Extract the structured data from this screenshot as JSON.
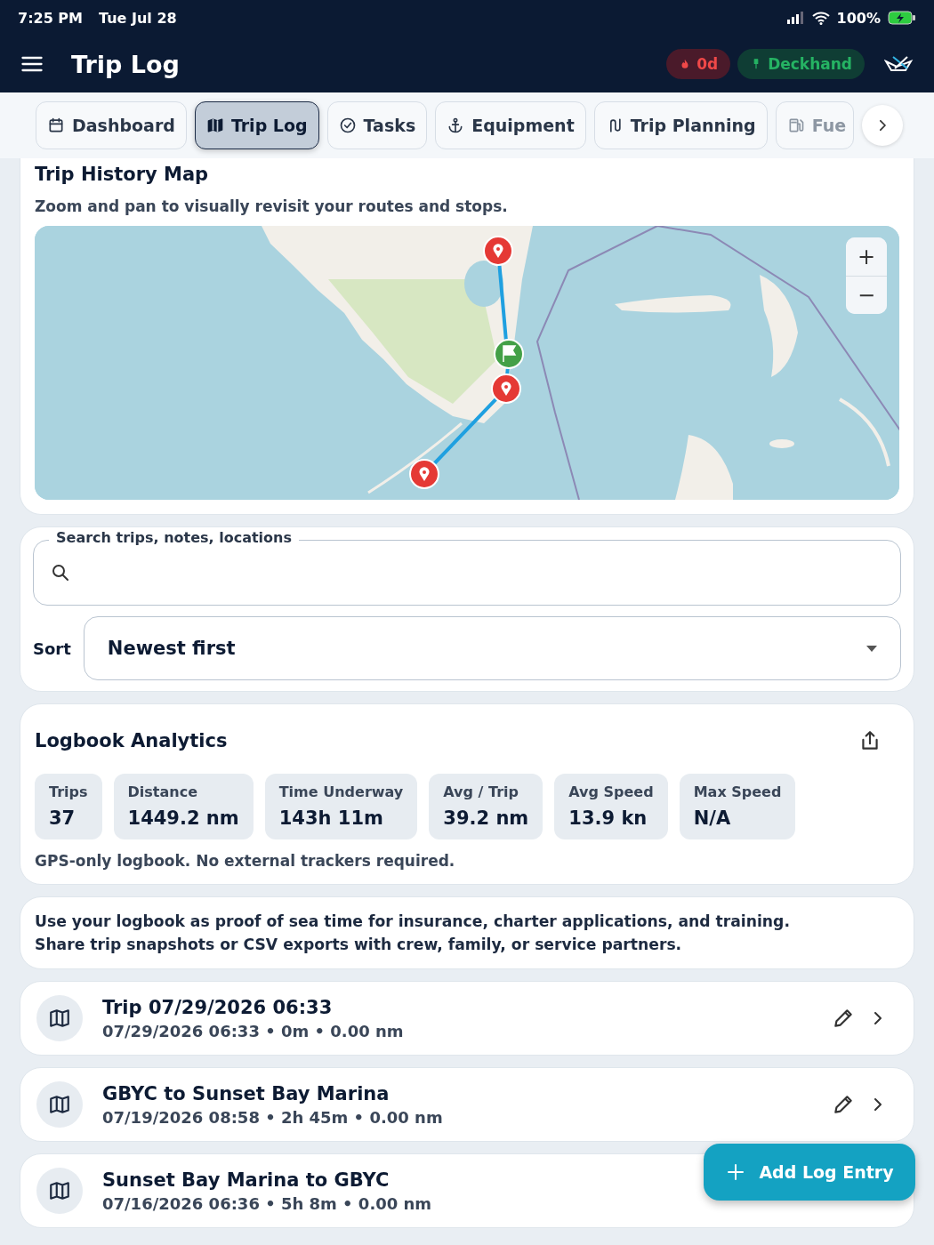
{
  "status_bar": {
    "time": "7:25 PM",
    "date": "Tue Jul 28",
    "battery": "100%"
  },
  "header": {
    "title": "Trip Log",
    "badges": [
      {
        "kind": "streak",
        "label": "0d"
      },
      {
        "kind": "rank",
        "label": "Deckhand"
      }
    ]
  },
  "tabs": [
    {
      "label": "Dashboard",
      "selected": false
    },
    {
      "label": "Trip Log",
      "selected": true
    },
    {
      "label": "Tasks",
      "selected": false
    },
    {
      "label": "Equipment",
      "selected": false
    },
    {
      "label": "Trip Planning",
      "selected": false
    },
    {
      "label": "Fue",
      "selected": false
    }
  ],
  "map_card": {
    "title": "Trip History Map",
    "subtitle": "Zoom and pan to visually revisit your routes and stops.",
    "zoom_in": "+",
    "zoom_out": "−"
  },
  "search": {
    "label": "Search trips, notes, locations"
  },
  "sort": {
    "label": "Sort",
    "value": "Newest first"
  },
  "analytics": {
    "title": "Logbook Analytics",
    "stats": [
      {
        "label": "Trips",
        "value": "37"
      },
      {
        "label": "Distance",
        "value": "1449.2 nm"
      },
      {
        "label": "Time Underway",
        "value": "143h 11m"
      },
      {
        "label": "Avg / Trip",
        "value": "39.2 nm"
      },
      {
        "label": "Avg Speed",
        "value": "13.9 kn"
      },
      {
        "label": "Max Speed",
        "value": "N/A"
      }
    ],
    "note": "GPS-only logbook. No external trackers required."
  },
  "info": {
    "lines": [
      "Use your logbook as proof of sea time for insurance, charter applications, and training.",
      "Share trip snapshots or CSV exports with crew, family, or service partners."
    ]
  },
  "trips": [
    {
      "title": "Trip 07/29/2026 06:33",
      "meta": "07/29/2026 06:33 • 0m • 0.00 nm"
    },
    {
      "title": "GBYC to Sunset Bay Marina",
      "meta": "07/19/2026 08:58 • 2h 45m • 0.00 nm"
    },
    {
      "title": "Sunset Bay Marina to GBYC",
      "meta": "07/16/2026 06:36 • 5h 8m • 0.00 nm"
    }
  ],
  "fab": {
    "label": "Add Log Entry"
  }
}
